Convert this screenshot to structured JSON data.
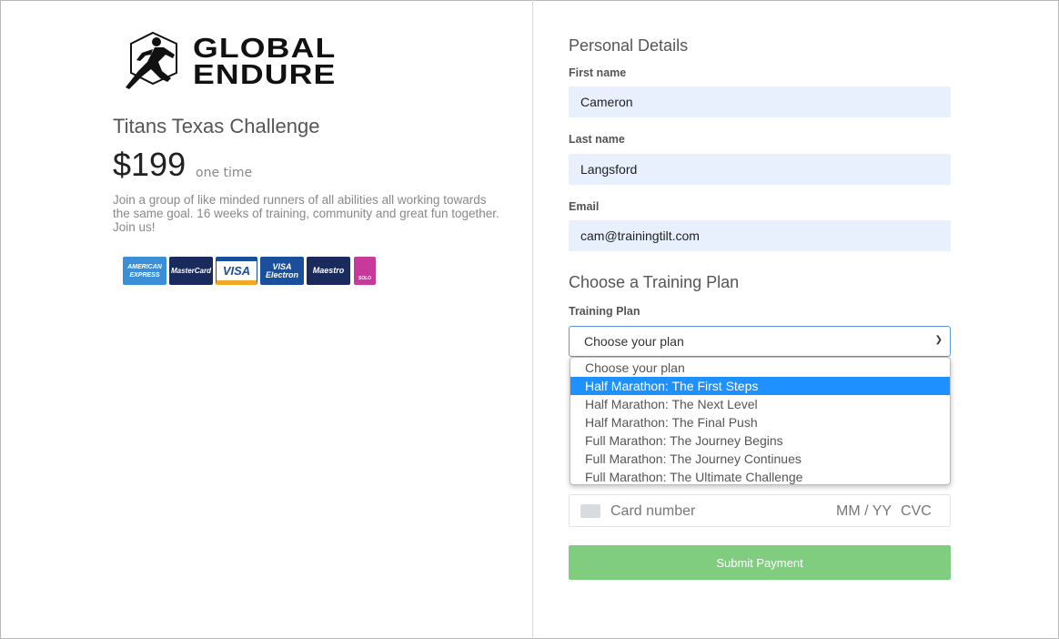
{
  "brand": {
    "name_line1": "GLOBAL",
    "name_line2": "ENDURE"
  },
  "event": {
    "title": "Titans Texas Challenge",
    "price": "$199",
    "frequency": "one time",
    "description": "Join a group of like minded runners of all abilities all working towards the same goal. 16 weeks of training, community and great fun together. Join us!"
  },
  "payment_cards": [
    {
      "name": "American Express",
      "label": "AMERICAN EXPRESS",
      "color": "#3b8fd8"
    },
    {
      "name": "MasterCard",
      "label": "MasterCard",
      "color": "#1a2a5c"
    },
    {
      "name": "Visa",
      "label": "VISA",
      "color": "#ffffff"
    },
    {
      "name": "Visa Electron",
      "label": "VISA Electron",
      "color": "#1a4f9c"
    },
    {
      "name": "Maestro",
      "label": "Maestro",
      "color": "#1a2a5c"
    },
    {
      "name": "Solo",
      "label": "SOLO",
      "color": "#c83a9a"
    }
  ],
  "personal": {
    "heading": "Personal Details",
    "first_name": {
      "label": "First name",
      "value": "Cameron"
    },
    "last_name": {
      "label": "Last name",
      "value": "Langsford"
    },
    "email": {
      "label": "Email",
      "value": "cam@trainingtilt.com"
    }
  },
  "plan": {
    "heading": "Choose a Training Plan",
    "label": "Training Plan",
    "selected": "Choose your plan",
    "options": [
      "Choose your plan",
      "Half Marathon: The First Steps",
      "Half Marathon: The Next Level",
      "Half Marathon: The Final Push",
      "Full Marathon: The Journey Begins",
      "Full Marathon: The Journey Continues",
      "Full Marathon: The Ultimate Challenge"
    ],
    "highlighted_index": 1
  },
  "card_field": {
    "placeholder": "Card number",
    "expiry_placeholder": "MM / YY",
    "cvc_placeholder": "CVC"
  },
  "submit_label": "Submit Payment",
  "colors": {
    "accent": "#1e90ff",
    "submit": "#80cd80",
    "autofill": "#e8f0fe"
  }
}
